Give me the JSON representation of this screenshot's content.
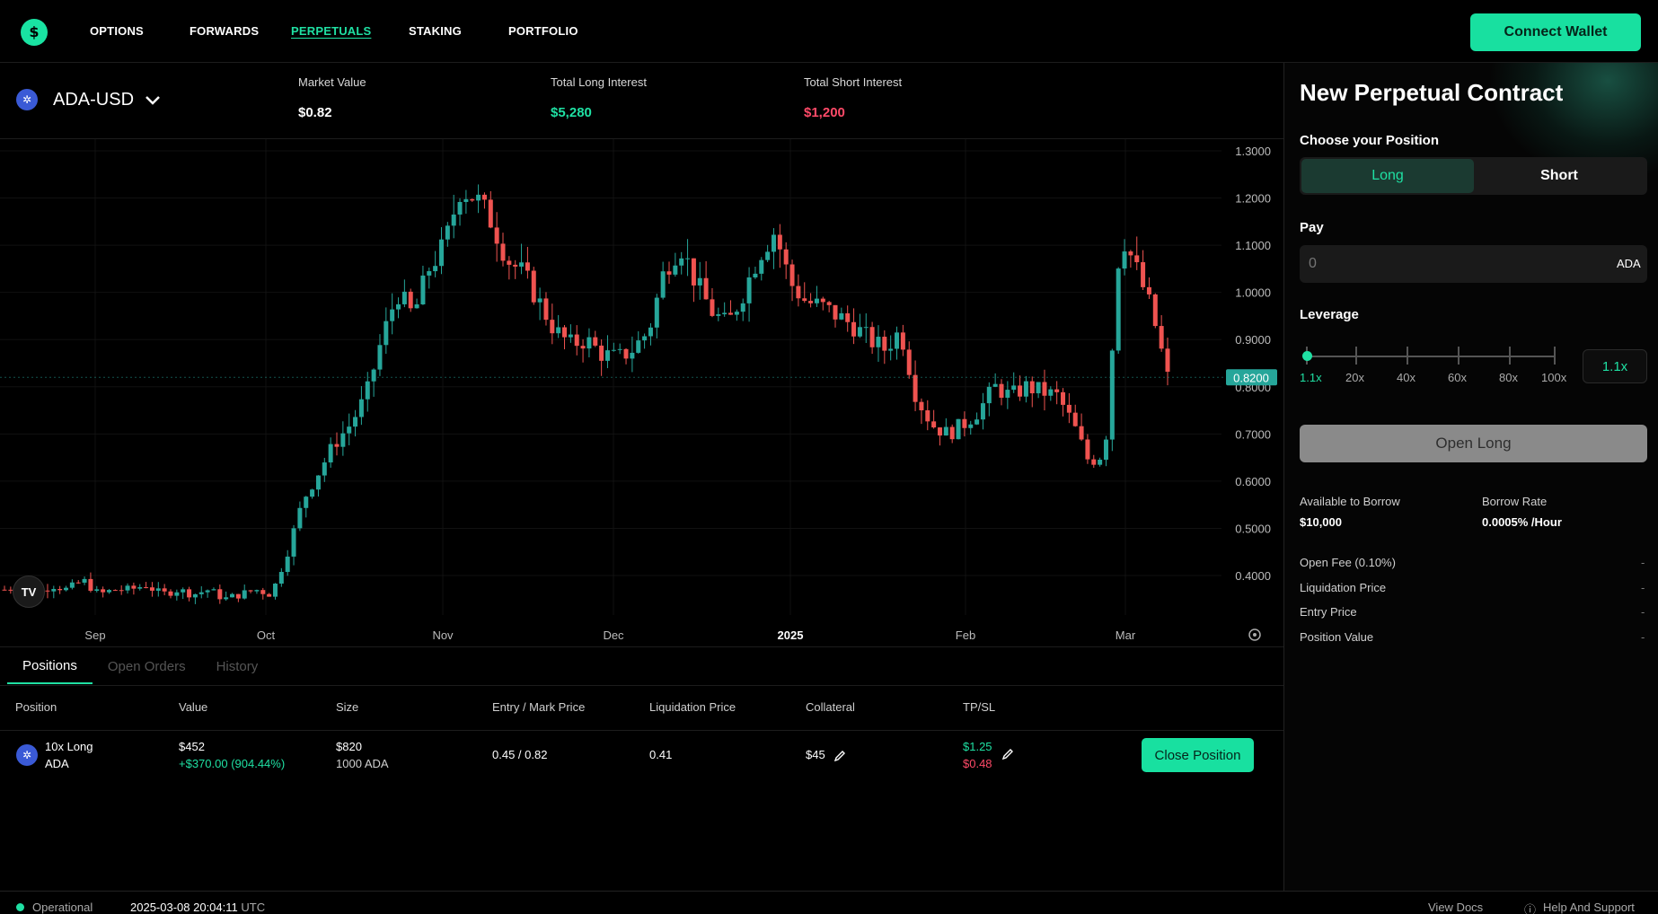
{
  "nav": {
    "items": [
      {
        "label": "OPTIONS",
        "active": false
      },
      {
        "label": "FORWARDS",
        "active": false
      },
      {
        "label": "PERPETUALS",
        "active": true
      },
      {
        "label": "STAKING",
        "active": false
      },
      {
        "label": "PORTFOLIO",
        "active": false
      }
    ],
    "connect_label": "Connect Wallet"
  },
  "market": {
    "pair": "ADA-USD",
    "stats": [
      {
        "label": "Market Value",
        "value": "$0.82",
        "color": "#ffffff"
      },
      {
        "label": "Total Long Interest",
        "value": "$5,280",
        "color": "#1fe0a3"
      },
      {
        "label": "Total Short Interest",
        "value": "$1,200",
        "color": "#ff4a68"
      }
    ]
  },
  "chart_data": {
    "type": "candlestick",
    "y_ticks": [
      "1.3000",
      "1.2000",
      "1.1000",
      "1.0000",
      "0.9000",
      "0.8000",
      "0.7000",
      "0.6000",
      "0.5000",
      "0.4000"
    ],
    "ylim": [
      0.32,
      1.33
    ],
    "x_labels": [
      "Sep",
      "Oct",
      "Nov",
      "Dec",
      "2025",
      "Feb",
      "Mar"
    ],
    "last_price": "0.8200",
    "up_color": "#26a69a",
    "down_color": "#ef5350",
    "close_path": [
      0.37,
      0.38,
      0.36,
      0.38,
      0.37,
      0.39,
      0.36,
      0.37,
      0.37,
      0.38,
      0.36,
      0.37,
      0.36,
      0.37,
      0.35,
      0.36,
      0.37,
      0.36,
      0.45,
      0.56,
      0.62,
      0.68,
      0.72,
      0.78,
      0.9,
      1.0,
      0.95,
      1.05,
      1.1,
      1.22,
      1.2,
      1.15,
      1.07,
      1.04,
      0.98,
      0.92,
      0.89,
      0.9,
      0.87,
      0.86,
      0.88,
      0.92,
      1.05,
      1.1,
      1.02,
      0.96,
      0.93,
      1.0,
      1.08,
      1.13,
      1.02,
      0.98,
      0.97,
      0.95,
      0.93,
      0.9,
      0.88,
      0.92,
      0.78,
      0.72,
      0.7,
      0.72,
      0.75,
      0.8,
      0.78,
      0.8,
      0.79,
      0.78,
      0.72,
      0.64,
      0.66,
      1.13,
      1.05,
      0.96,
      0.82
    ],
    "positions": {
      "tabs": [
        "Positions",
        "Open Orders",
        "History"
      ],
      "headers": [
        "Position",
        "Value",
        "Size",
        "Entry / Mark Price",
        "Liquidation Price",
        "Collateral",
        "TP/SL"
      ],
      "row": {
        "position_line1": "10x Long",
        "position_line2": "ADA",
        "value": "$452",
        "pnl": "+$370.00 (904.44%)",
        "size": "$820",
        "size_sub": "1000 ADA",
        "entry_mark": "0.45 / 0.82",
        "liquidation": "0.41",
        "collateral": "$45",
        "tp": "$1.25",
        "sl": "$0.48",
        "close_label": "Close Position"
      }
    }
  },
  "order": {
    "title": "New Perpetual Contract",
    "choose_label": "Choose your Position",
    "long_label": "Long",
    "short_label": "Short",
    "pay_label": "Pay",
    "pay_placeholder": "0",
    "pay_unit": "ADA",
    "leverage_label": "Leverage",
    "leverage_ticks": [
      "1.1x",
      "20x",
      "40x",
      "60x",
      "80x",
      "100x"
    ],
    "leverage_value": "1.1x",
    "open_label": "Open Long",
    "available_label": "Available to Borrow",
    "available_value": "$10,000",
    "rate_label": "Borrow Rate",
    "rate_value": "0.0005% /Hour",
    "details": [
      {
        "label": "Open Fee (0.10%)",
        "value": "-"
      },
      {
        "label": "Liquidation Price",
        "value": "-"
      },
      {
        "label": "Entry Price",
        "value": "-"
      },
      {
        "label": "Position Value",
        "value": "-"
      }
    ]
  },
  "footer": {
    "status": "Operational",
    "datetime": "2025-03-08 20:04:11",
    "tz": "UTC",
    "docs": "View Docs",
    "help": "Help And Support"
  }
}
